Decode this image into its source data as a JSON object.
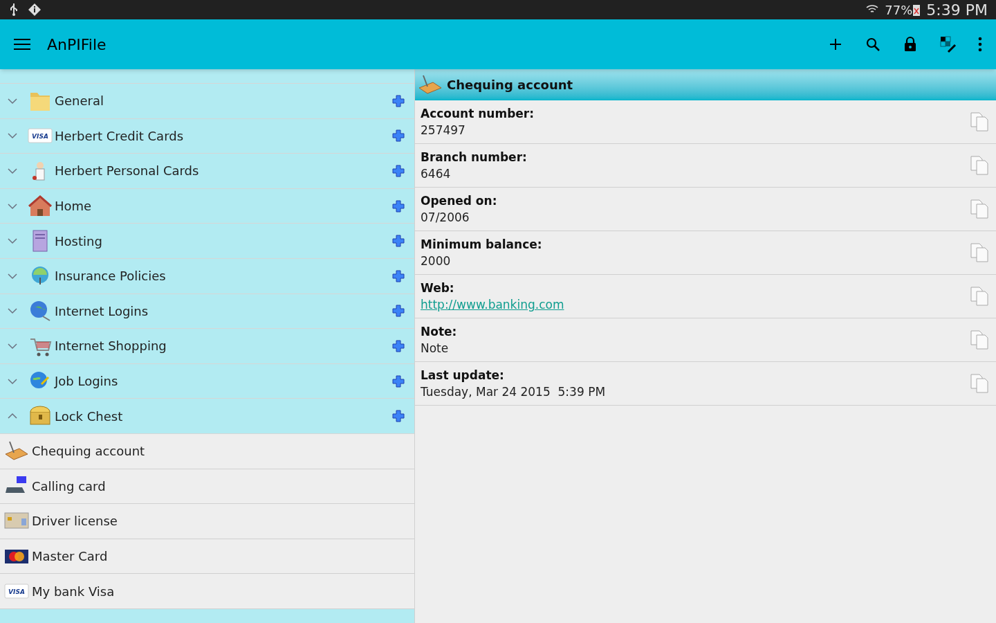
{
  "status_bar": {
    "battery": "77%",
    "time": "5:39 PM"
  },
  "app_bar": {
    "title": "AnPIFile"
  },
  "groups": [
    {
      "label": "General",
      "expanded": false
    },
    {
      "label": "Herbert Credit Cards",
      "expanded": false,
      "icon_text": "VISA"
    },
    {
      "label": "Herbert Personal Cards",
      "expanded": false
    },
    {
      "label": "Home",
      "expanded": false
    },
    {
      "label": "Hosting",
      "expanded": false
    },
    {
      "label": "Insurance Policies",
      "expanded": false
    },
    {
      "label": "Internet Logins",
      "expanded": false
    },
    {
      "label": "Internet Shopping",
      "expanded": false
    },
    {
      "label": "Job Logins",
      "expanded": false
    },
    {
      "label": "Lock Chest",
      "expanded": true,
      "children": [
        {
          "label": "Chequing account"
        },
        {
          "label": "Calling card"
        },
        {
          "label": "Driver license"
        },
        {
          "label": "Master Card"
        },
        {
          "label": "My bank Visa",
          "icon_text": "VISA"
        }
      ]
    }
  ],
  "detail": {
    "title": "Chequing account",
    "fields": [
      {
        "label": "Account number:",
        "value": "257497",
        "kind": "text"
      },
      {
        "label": "Branch number:",
        "value": "6464",
        "kind": "text"
      },
      {
        "label": "Opened on:",
        "value": "07/2006",
        "kind": "text"
      },
      {
        "label": "Minimum balance:",
        "value": "2000",
        "kind": "text"
      },
      {
        "label": "Web:",
        "value": "http://www.banking.com",
        "kind": "link"
      },
      {
        "label": "Note:",
        "value": "Note",
        "kind": "text"
      },
      {
        "label": "Last update:",
        "value": "Tuesday, Mar 24 2015  5:39 PM",
        "kind": "text"
      }
    ]
  }
}
